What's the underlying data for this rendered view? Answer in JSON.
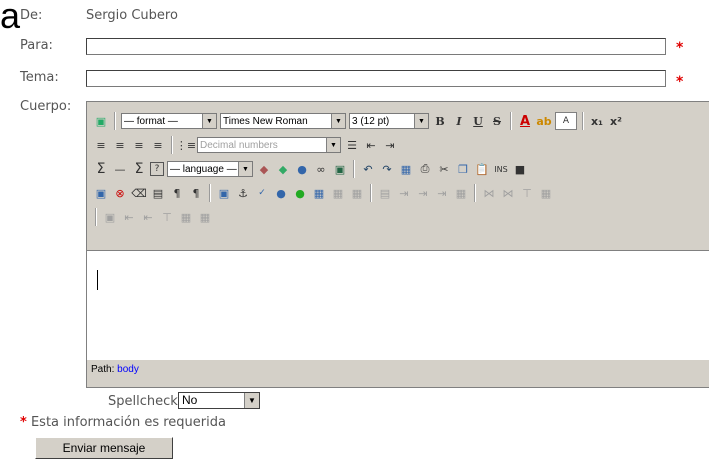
{
  "form": {
    "de_label": "De:",
    "de_value": "Sergio Cubero",
    "para_label": "Para:",
    "tema_label": "Tema:",
    "cuerpo_label": "Cuerpo:",
    "required_mark": "*",
    "spellcheck_label": "Spellcheck:",
    "spellcheck_value": "No",
    "required_note": "Esta información es requerida",
    "send_label": "Enviar mensaje",
    "corner_letter": "a"
  },
  "toolbar": {
    "format_select": "— format —",
    "font_select": "Times New Roman",
    "size_select": "3 (12 pt)",
    "list_select": "Decimal numbers",
    "language_select": "— language —",
    "bold": "B",
    "italic": "I",
    "underline": "U",
    "strike": "S",
    "sigma": "Σ"
  },
  "editor": {
    "path_label": "Path:",
    "path_value": "body"
  },
  "colors": {
    "required": "#e00000",
    "toolbar_bg": "#d4d0c8"
  }
}
